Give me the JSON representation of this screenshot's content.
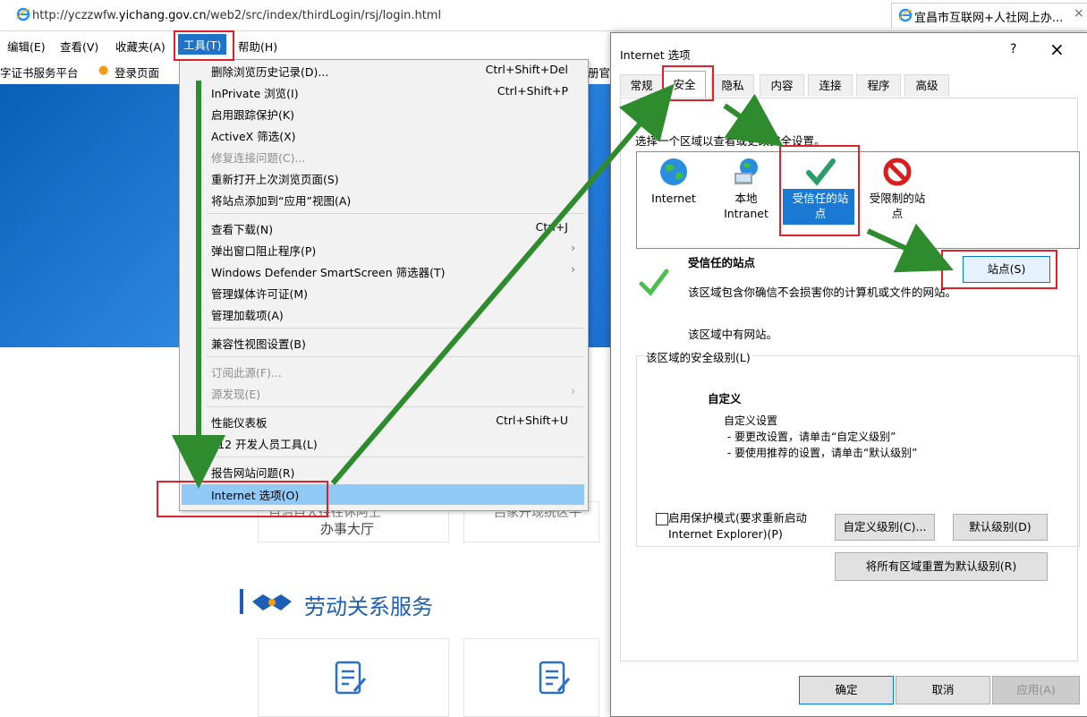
{
  "browser": {
    "url_prefix": "http://yczzwfw.",
    "url_host": "yichang.gov.cn",
    "url_path": "/web2/src/index/thirdLogin/rsj/login.html",
    "search_ctrl": "⌕ ▾ ↻",
    "tab_title": "宜昌市互联网+人社网上办...",
    "tab_close": "×"
  },
  "menubar": {
    "edit": "编辑(E)",
    "view": "查看(V)",
    "favorites": "收藏夹(A)",
    "tools": "工具(T)",
    "help": "帮助(H)"
  },
  "favbar": {
    "item1": "字证书服务平台",
    "item2": "登录页面",
    "item3": "册官"
  },
  "page": {
    "card1_line1": "自治自大往往休阿上",
    "card1_line2": "办事大厅",
    "card2_line1": "吕家开现统区平",
    "section_title": "劳动关系服务"
  },
  "tools_menu": {
    "items": [
      {
        "label": "删除浏览历史记录(D)...",
        "shortcut": "Ctrl+Shift+Del"
      },
      {
        "label": "InPrivate 浏览(I)",
        "shortcut": "Ctrl+Shift+P"
      },
      {
        "label": "启用跟踪保护(K)",
        "shortcut": ""
      },
      {
        "label": "ActiveX 筛选(X)",
        "shortcut": ""
      },
      {
        "label": "修复连接问题(C)...",
        "shortcut": ""
      },
      {
        "label": "重新打开上次浏览页面(S)",
        "shortcut": ""
      },
      {
        "label": "将站点添加到“应用”视图(A)",
        "shortcut": ""
      },
      {
        "label": "查看下载(N)",
        "shortcut": "Ctrl+J"
      },
      {
        "label": "弹出窗口阻止程序(P)",
        "shortcut": ""
      },
      {
        "label": "Windows Defender SmartScreen 筛选器(T)",
        "shortcut": ""
      },
      {
        "label": "管理媒体许可证(M)",
        "shortcut": ""
      },
      {
        "label": "管理加载项(A)",
        "shortcut": ""
      },
      {
        "label": "兼容性视图设置(B)",
        "shortcut": ""
      },
      {
        "label": "订阅此源(F)...",
        "shortcut": ""
      },
      {
        "label": "源发现(E)",
        "shortcut": ""
      },
      {
        "label": "性能仪表板",
        "shortcut": "Ctrl+Shift+U"
      },
      {
        "label": "F12 开发人员工具(L)",
        "shortcut": ""
      },
      {
        "label": "报告网站问题(R)",
        "shortcut": ""
      },
      {
        "label": "Internet 选项(O)",
        "shortcut": ""
      }
    ]
  },
  "dialog": {
    "title": "Internet 选项",
    "help": "?",
    "close": "×",
    "tabs": [
      "常规",
      "安全",
      "隐私",
      "内容",
      "连接",
      "程序",
      "高级"
    ],
    "zone_prompt": "选择一个区域以查看或更改安全设置。",
    "zones": [
      {
        "line1": "Internet",
        "line2": ""
      },
      {
        "line1": "本地",
        "line2": "Intranet"
      },
      {
        "line1": "受信任的站",
        "line2": "点"
      },
      {
        "line1": "受限制的站",
        "line2": "点"
      }
    ],
    "zone_name": "受信任的站点",
    "zone_desc": "该区域包含你确信不会损害你的计算机或文件的网站。",
    "zone_note": "该区域中有网站。",
    "sites_button": "站点(S)",
    "group_label": "该区域的安全级别(L)",
    "level_name": "自定义",
    "level_desc": "自定义设置\n - 要更改设置，请单击“自定义级别”\n - 要使用推荐的设置，请单击“默认级别”",
    "protect_mode_line1": "启用保护模式(要求重新启动",
    "protect_mode_line2": "Internet Explorer)(P)",
    "custom_level_button": "自定义级别(C)...",
    "default_level_button": "默认级别(D)",
    "reset_all_button": "将所有区域重置为默认级别(R)",
    "ok_button": "确定",
    "cancel_button": "取消",
    "apply_button": "应用(A)"
  },
  "colors": {
    "highlight_menu": "#1e72c8",
    "menu_hover": "#91c9f7",
    "annotation_red": "#e0202a",
    "annotation_arrow": "#2e8b2e",
    "zone_selected": "#1979d3"
  }
}
